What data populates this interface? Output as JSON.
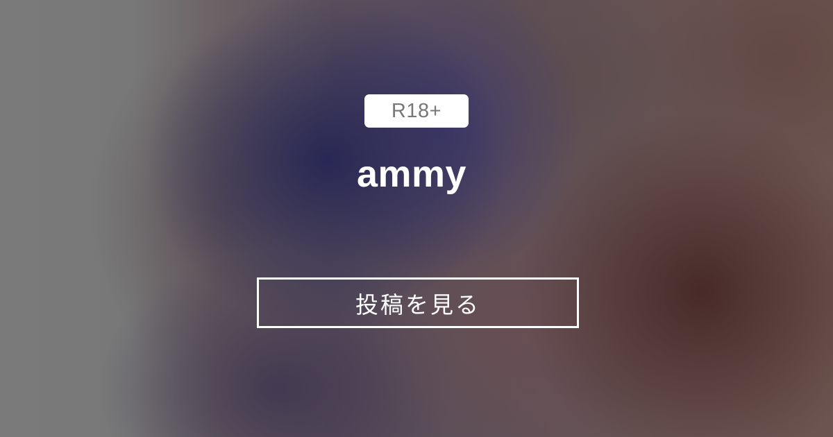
{
  "badge": {
    "label": "R18+"
  },
  "creator": {
    "name": "ammy"
  },
  "action": {
    "view_posts_label": "投稿を見る"
  }
}
